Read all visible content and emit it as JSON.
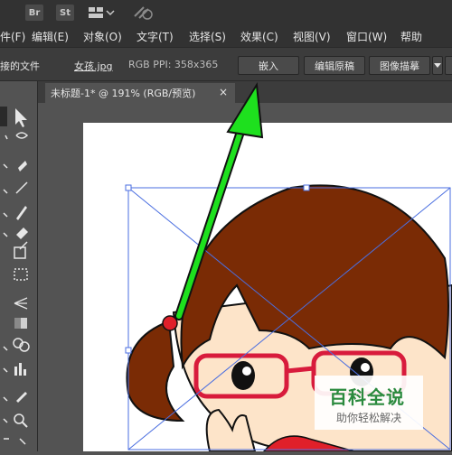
{
  "appbar": {
    "br_label": "Br",
    "st_label": "St"
  },
  "menu": [
    {
      "label": "件(F)"
    },
    {
      "label": "编辑(E)"
    },
    {
      "label": "对象(O)"
    },
    {
      "label": "文字(T)"
    },
    {
      "label": "选择(S)"
    },
    {
      "label": "效果(C)"
    },
    {
      "label": "视图(V)"
    },
    {
      "label": "窗口(W)"
    },
    {
      "label": "帮助"
    }
  ],
  "control": {
    "linked_file": "接的文件",
    "filename": "女孩.jpg",
    "info": "RGB  PPI: 358x365",
    "embed_button": "嵌入",
    "edit_original_button": "编辑原稿",
    "image_trace_button": "图像描摹"
  },
  "document": {
    "tab_title": "未标题-1* @ 191% (RGB/预览)",
    "close_glyph": "×"
  },
  "watermark": {
    "main": "百科全说",
    "sub": "助你轻松解决"
  },
  "colors": {
    "arrow": "#1ee01e",
    "hair": "#7a2b05",
    "glasses": "#d81b3c",
    "selection": "#4a6ee0"
  }
}
